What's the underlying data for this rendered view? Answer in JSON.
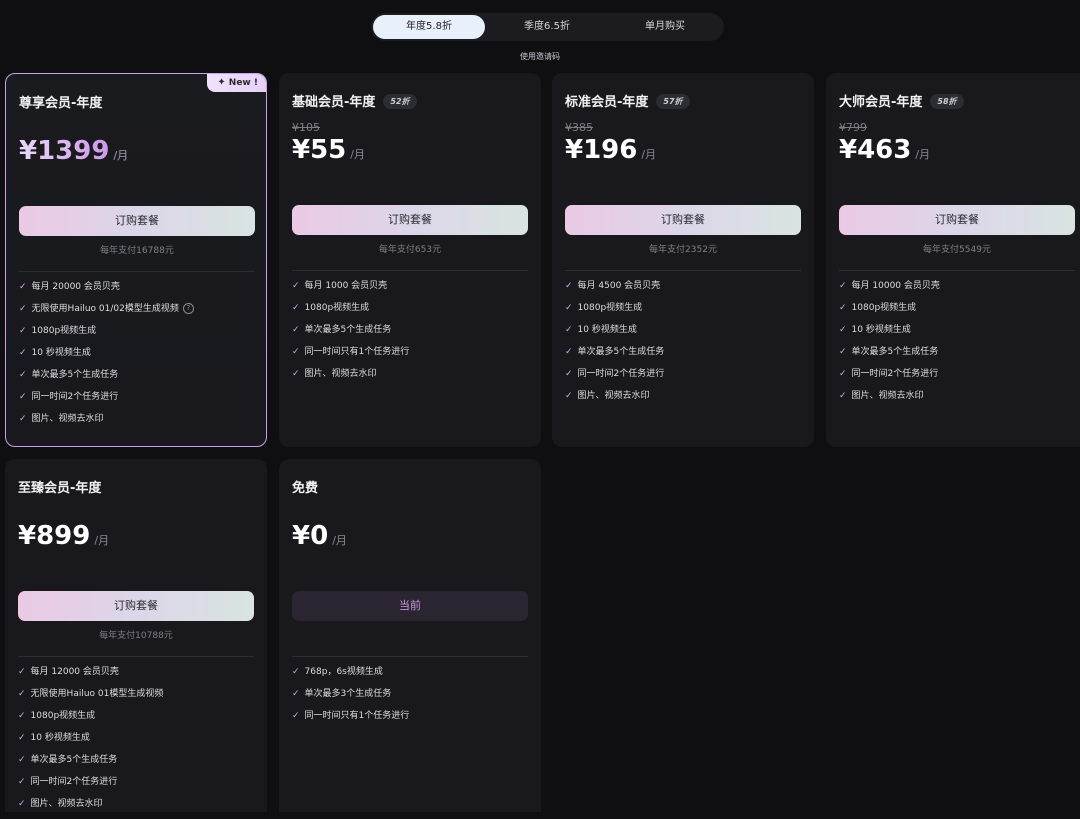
{
  "tabs": [
    {
      "label": "年度5.8折",
      "active": true
    },
    {
      "label": "季度6.5折",
      "active": false
    },
    {
      "label": "单月购买",
      "active": false
    }
  ],
  "coupon_link": "使用邀请码",
  "plans": [
    {
      "title": "尊享会员-年度",
      "badge": "New !",
      "price": "¥1399",
      "per": "/月",
      "button": "订购套餐",
      "yearly": "每年支付16788元",
      "features": [
        "每月 20000 会员贝壳",
        "无限使用Hailuo 01/02模型生成视频",
        "1080p视频生成",
        "10 秒视频生成",
        "单次最多5个生成任务",
        "同一时间2个任务进行",
        "图片、视频去水印"
      ]
    },
    {
      "title": "基础会员-年度",
      "discount": "52折",
      "original": "¥105",
      "price": "¥55",
      "per": "/月",
      "button": "订购套餐",
      "yearly": "每年支付653元",
      "features": [
        "每月 1000 会员贝壳",
        "1080p视频生成",
        "单次最多5个生成任务",
        "同一时间只有1个任务进行",
        "图片、视频去水印"
      ]
    },
    {
      "title": "标准会员-年度",
      "discount": "57折",
      "original": "¥385",
      "price": "¥196",
      "per": "/月",
      "button": "订购套餐",
      "yearly": "每年支付2352元",
      "features": [
        "每月 4500 会员贝壳",
        "1080p视频生成",
        "10 秒视频生成",
        "单次最多5个生成任务",
        "同一时间2个任务进行",
        "图片、视频去水印"
      ]
    },
    {
      "title": "大师会员-年度",
      "discount": "58折",
      "original": "¥799",
      "price": "¥463",
      "per": "/月",
      "button": "订购套餐",
      "yearly": "每年支付5549元",
      "features": [
        "每月 10000 会员贝壳",
        "1080p视频生成",
        "10 秒视频生成",
        "单次最多5个生成任务",
        "同一时间2个任务进行",
        "图片、视频去水印"
      ]
    },
    {
      "title": "至臻会员-年度",
      "price": "¥899",
      "per": "/月",
      "button": "订购套餐",
      "yearly": "每年支付10788元",
      "features": [
        "每月 12000 会员贝壳",
        "无限使用Hailuo 01模型生成视频",
        "1080p视频生成",
        "10 秒视频生成",
        "单次最多5个生成任务",
        "同一时间2个任务进行",
        "图片、视频去水印"
      ]
    },
    {
      "title": "免费",
      "price": "¥0",
      "per": "/月",
      "button": "当前",
      "features": [
        "768p，6s视频生成",
        "单次最多3个生成任务",
        "同一时间只有1个任务进行"
      ]
    }
  ],
  "check_icon": "check-icon",
  "help_icon": "question-circle-icon",
  "accent_color": "#c9a3ea"
}
